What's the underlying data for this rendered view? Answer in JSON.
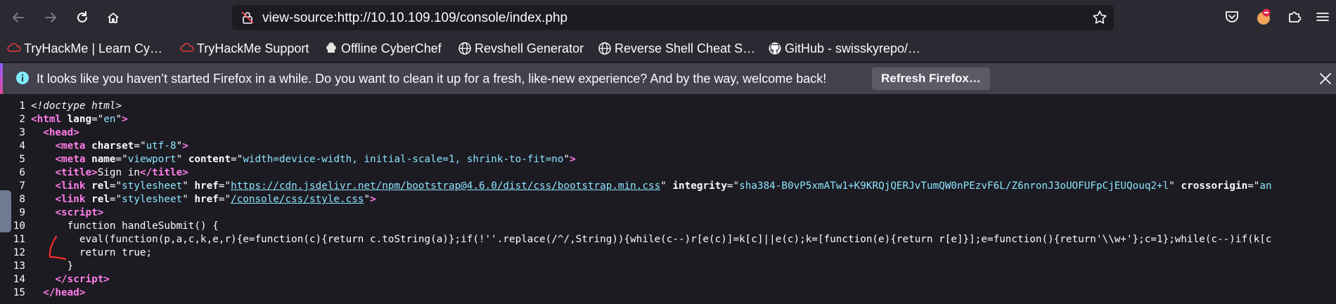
{
  "toolbar": {
    "back_icon": "arrow-left-icon",
    "forward_icon": "arrow-right-icon",
    "reload_icon": "reload-icon",
    "home_icon": "home-icon",
    "url": "view-source:http://10.10.109.109/console/index.php"
  },
  "bookmarks": [
    {
      "label": "TryHackMe | Learn Cy…",
      "icon": "tryhackme-icon"
    },
    {
      "label": "TryHackMe Support",
      "icon": "tryhackme-icon"
    },
    {
      "label": "Offline CyberChef",
      "icon": "chef-icon"
    },
    {
      "label": "Revshell Generator",
      "icon": "globe-icon"
    },
    {
      "label": "Reverse Shell Cheat S…",
      "icon": "globe-icon"
    },
    {
      "label": "GitHub - swisskyrepo/…",
      "icon": "github-icon"
    }
  ],
  "notification": {
    "message": "It looks like you haven’t started Firefox in a while. Do you want to clean it up for a fresh, like-new experience? And by the way, welcome back!",
    "button": "Refresh Firefox…"
  },
  "source_lines": [
    {
      "n": "1",
      "html": "<span class=\"c\">&lt;!doctype html&gt;</span>"
    },
    {
      "n": "2",
      "html": "<span class=\"t\">&lt;html</span> <span class=\"a\">lang</span>=\"<span class=\"v\">en</span>\"<span class=\"t\">&gt;</span>"
    },
    {
      "n": "3",
      "html": "  <span class=\"t\">&lt;head&gt;</span>"
    },
    {
      "n": "4",
      "html": "    <span class=\"t\">&lt;meta</span> <span class=\"a\">charset</span>=\"<span class=\"v\">utf-8</span>\"<span class=\"t\">&gt;</span>"
    },
    {
      "n": "5",
      "html": "    <span class=\"t\">&lt;meta</span> <span class=\"a\">name</span>=\"<span class=\"v\">viewport</span>\" <span class=\"a\">content</span>=\"<span class=\"v\">width=device-width, initial-scale=1, shrink-to-fit=no</span>\"<span class=\"t\">&gt;</span>"
    },
    {
      "n": "6",
      "html": "    <span class=\"t\">&lt;title&gt;</span>Sign in<span class=\"t\">&lt;/title&gt;</span>"
    },
    {
      "n": "7",
      "html": "    <span class=\"t\">&lt;link</span> <span class=\"a\">rel</span>=\"<span class=\"v\">stylesheet</span>\" <span class=\"a\">href</span>=\"<span class=\"lk\">https://cdn.jsdelivr.net/npm/bootstrap@4.6.0/dist/css/bootstrap.min.css</span>\" <span class=\"a\">integrity</span>=\"<span class=\"v\">sha384-B0vP5xmATw1+K9KRQjQERJvTumQW0nPEzvF6L/Z6nronJ3oUOFUFpCjEUQouq2+l</span>\" <span class=\"a\">crossorigin</span>=\"<span class=\"v\">an</span>"
    },
    {
      "n": "8",
      "html": "    <span class=\"t\">&lt;link</span> <span class=\"a\">rel</span>=\"<span class=\"v\">stylesheet</span>\" <span class=\"a\">href</span>=\"<span class=\"lk\">/console/css/style.css</span>\"<span class=\"t\">&gt;</span>"
    },
    {
      "n": "9",
      "html": "    <span class=\"t\">&lt;script&gt;</span>"
    },
    {
      "n": "10",
      "html": "      function handleSubmit() {"
    },
    {
      "n": "11",
      "html": "        eval(function(p,a,c,k,e,r){e=function(c){return c.toString(a)};if(!''.replace(/^/,String)){while(c--)r[e(c)]=k[c]||e(c);k=[function(e){return r[e]}];e=function(){return'\\\\w+'};c=1};while(c--)if(k[c"
    },
    {
      "n": "12",
      "html": "        return true;"
    },
    {
      "n": "13",
      "html": "      }"
    },
    {
      "n": "14",
      "html": "    <span class=\"t\">&lt;/script&gt;</span>"
    },
    {
      "n": "15",
      "html": "  <span class=\"t\">&lt;/head&gt;</span>"
    }
  ],
  "colors": {
    "tag": "#ff7de9",
    "value": "#8de4ff",
    "toolbar_bg": "#2b2a33",
    "page_bg": "#1c1b22"
  }
}
